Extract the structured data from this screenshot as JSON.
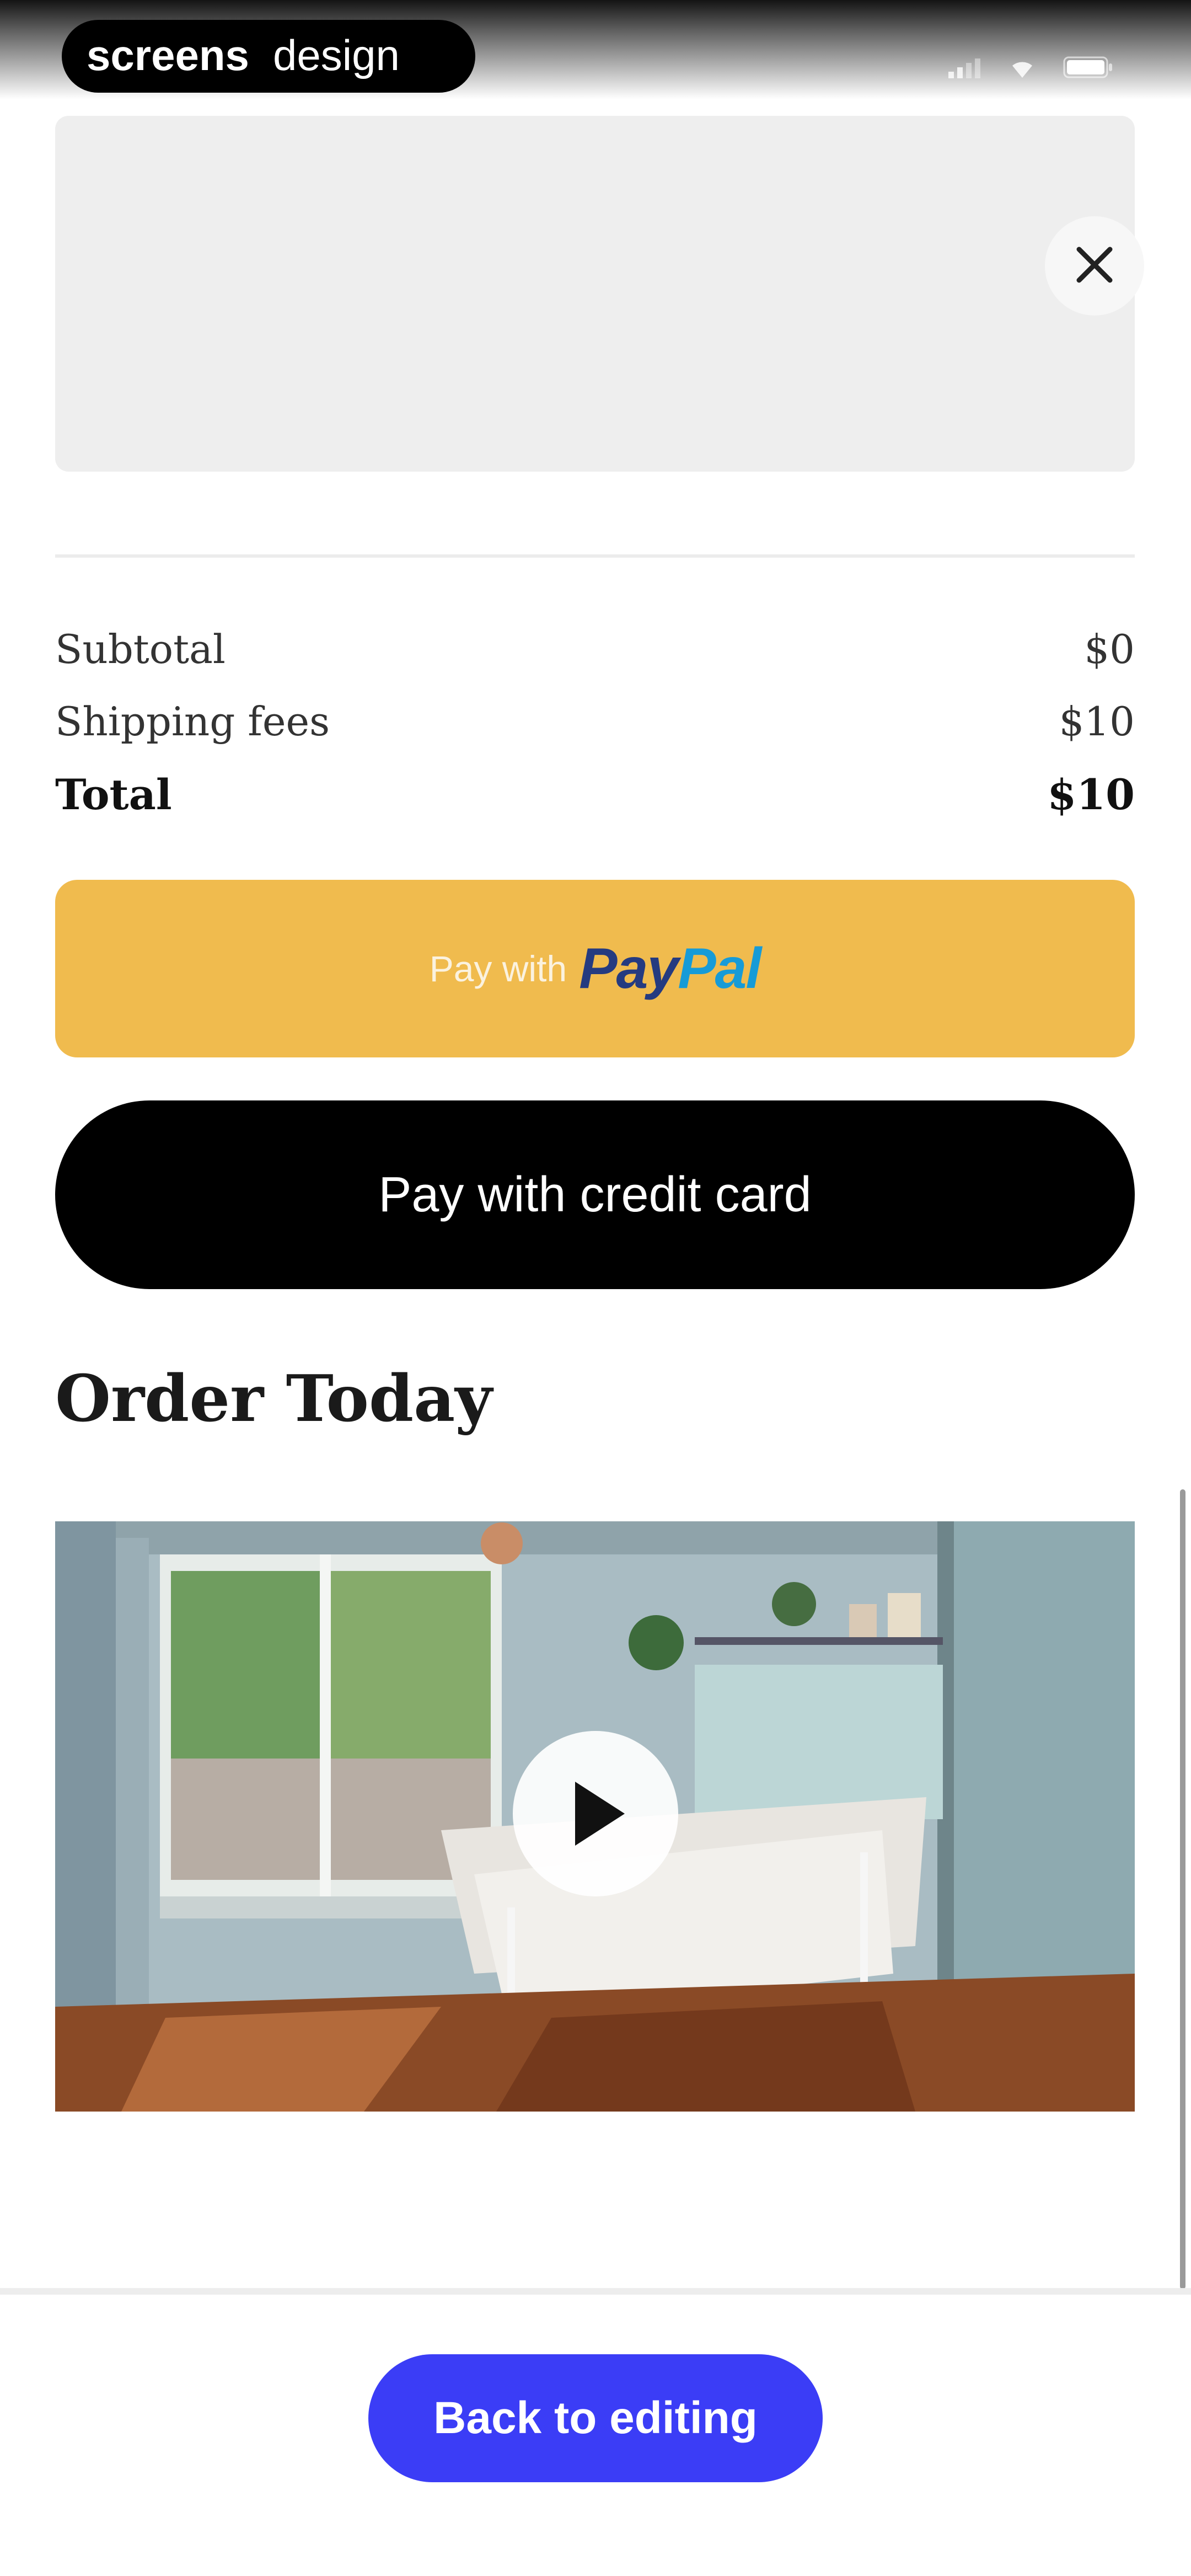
{
  "watermark": {
    "text": "screensdesign"
  },
  "status_bar": {
    "icons": [
      "cellular-signal-icon",
      "wifi-icon",
      "battery-icon"
    ]
  },
  "close_button": {
    "icon": "close-icon"
  },
  "summary": {
    "subtotal_label": "Subtotal",
    "subtotal_value": "$0",
    "shipping_label": "Shipping fees",
    "shipping_value": "$10",
    "total_label": "Total",
    "total_value": "$10"
  },
  "paypal_button": {
    "prefix": "Pay with",
    "brand_part1": "Pay",
    "brand_part2": "Pal",
    "color": "#f0bb4e"
  },
  "card_button": {
    "label": "Pay with credit card"
  },
  "order_section": {
    "title": "Order Today"
  },
  "video": {
    "play_icon": "play-icon"
  },
  "footer": {
    "back_label": "Back to editing",
    "accent": "#3b3df6"
  }
}
